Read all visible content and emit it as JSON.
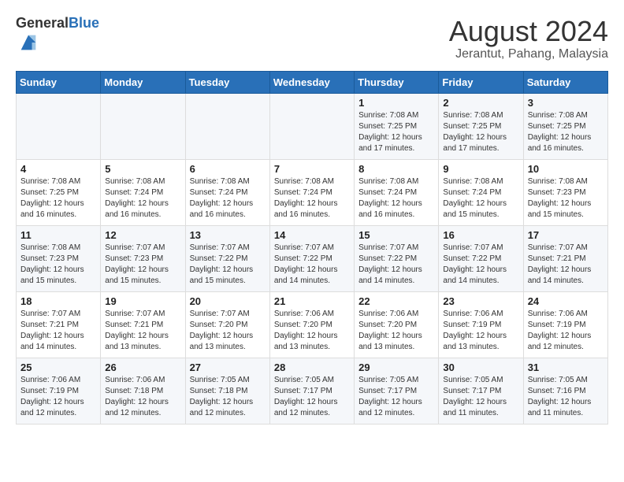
{
  "header": {
    "logo_general": "General",
    "logo_blue": "Blue",
    "month_year": "August 2024",
    "location": "Jerantut, Pahang, Malaysia"
  },
  "weekdays": [
    "Sunday",
    "Monday",
    "Tuesday",
    "Wednesday",
    "Thursday",
    "Friday",
    "Saturday"
  ],
  "weeks": [
    [
      {
        "day": "",
        "info": ""
      },
      {
        "day": "",
        "info": ""
      },
      {
        "day": "",
        "info": ""
      },
      {
        "day": "",
        "info": ""
      },
      {
        "day": "1",
        "info": "Sunrise: 7:08 AM\nSunset: 7:25 PM\nDaylight: 12 hours\nand 17 minutes."
      },
      {
        "day": "2",
        "info": "Sunrise: 7:08 AM\nSunset: 7:25 PM\nDaylight: 12 hours\nand 17 minutes."
      },
      {
        "day": "3",
        "info": "Sunrise: 7:08 AM\nSunset: 7:25 PM\nDaylight: 12 hours\nand 16 minutes."
      }
    ],
    [
      {
        "day": "4",
        "info": "Sunrise: 7:08 AM\nSunset: 7:25 PM\nDaylight: 12 hours\nand 16 minutes."
      },
      {
        "day": "5",
        "info": "Sunrise: 7:08 AM\nSunset: 7:24 PM\nDaylight: 12 hours\nand 16 minutes."
      },
      {
        "day": "6",
        "info": "Sunrise: 7:08 AM\nSunset: 7:24 PM\nDaylight: 12 hours\nand 16 minutes."
      },
      {
        "day": "7",
        "info": "Sunrise: 7:08 AM\nSunset: 7:24 PM\nDaylight: 12 hours\nand 16 minutes."
      },
      {
        "day": "8",
        "info": "Sunrise: 7:08 AM\nSunset: 7:24 PM\nDaylight: 12 hours\nand 16 minutes."
      },
      {
        "day": "9",
        "info": "Sunrise: 7:08 AM\nSunset: 7:24 PM\nDaylight: 12 hours\nand 15 minutes."
      },
      {
        "day": "10",
        "info": "Sunrise: 7:08 AM\nSunset: 7:23 PM\nDaylight: 12 hours\nand 15 minutes."
      }
    ],
    [
      {
        "day": "11",
        "info": "Sunrise: 7:08 AM\nSunset: 7:23 PM\nDaylight: 12 hours\nand 15 minutes."
      },
      {
        "day": "12",
        "info": "Sunrise: 7:07 AM\nSunset: 7:23 PM\nDaylight: 12 hours\nand 15 minutes."
      },
      {
        "day": "13",
        "info": "Sunrise: 7:07 AM\nSunset: 7:22 PM\nDaylight: 12 hours\nand 15 minutes."
      },
      {
        "day": "14",
        "info": "Sunrise: 7:07 AM\nSunset: 7:22 PM\nDaylight: 12 hours\nand 14 minutes."
      },
      {
        "day": "15",
        "info": "Sunrise: 7:07 AM\nSunset: 7:22 PM\nDaylight: 12 hours\nand 14 minutes."
      },
      {
        "day": "16",
        "info": "Sunrise: 7:07 AM\nSunset: 7:22 PM\nDaylight: 12 hours\nand 14 minutes."
      },
      {
        "day": "17",
        "info": "Sunrise: 7:07 AM\nSunset: 7:21 PM\nDaylight: 12 hours\nand 14 minutes."
      }
    ],
    [
      {
        "day": "18",
        "info": "Sunrise: 7:07 AM\nSunset: 7:21 PM\nDaylight: 12 hours\nand 14 minutes."
      },
      {
        "day": "19",
        "info": "Sunrise: 7:07 AM\nSunset: 7:21 PM\nDaylight: 12 hours\nand 13 minutes."
      },
      {
        "day": "20",
        "info": "Sunrise: 7:07 AM\nSunset: 7:20 PM\nDaylight: 12 hours\nand 13 minutes."
      },
      {
        "day": "21",
        "info": "Sunrise: 7:06 AM\nSunset: 7:20 PM\nDaylight: 12 hours\nand 13 minutes."
      },
      {
        "day": "22",
        "info": "Sunrise: 7:06 AM\nSunset: 7:20 PM\nDaylight: 12 hours\nand 13 minutes."
      },
      {
        "day": "23",
        "info": "Sunrise: 7:06 AM\nSunset: 7:19 PM\nDaylight: 12 hours\nand 13 minutes."
      },
      {
        "day": "24",
        "info": "Sunrise: 7:06 AM\nSunset: 7:19 PM\nDaylight: 12 hours\nand 12 minutes."
      }
    ],
    [
      {
        "day": "25",
        "info": "Sunrise: 7:06 AM\nSunset: 7:19 PM\nDaylight: 12 hours\nand 12 minutes."
      },
      {
        "day": "26",
        "info": "Sunrise: 7:06 AM\nSunset: 7:18 PM\nDaylight: 12 hours\nand 12 minutes."
      },
      {
        "day": "27",
        "info": "Sunrise: 7:05 AM\nSunset: 7:18 PM\nDaylight: 12 hours\nand 12 minutes."
      },
      {
        "day": "28",
        "info": "Sunrise: 7:05 AM\nSunset: 7:17 PM\nDaylight: 12 hours\nand 12 minutes."
      },
      {
        "day": "29",
        "info": "Sunrise: 7:05 AM\nSunset: 7:17 PM\nDaylight: 12 hours\nand 12 minutes."
      },
      {
        "day": "30",
        "info": "Sunrise: 7:05 AM\nSunset: 7:17 PM\nDaylight: 12 hours\nand 11 minutes."
      },
      {
        "day": "31",
        "info": "Sunrise: 7:05 AM\nSunset: 7:16 PM\nDaylight: 12 hours\nand 11 minutes."
      }
    ]
  ]
}
